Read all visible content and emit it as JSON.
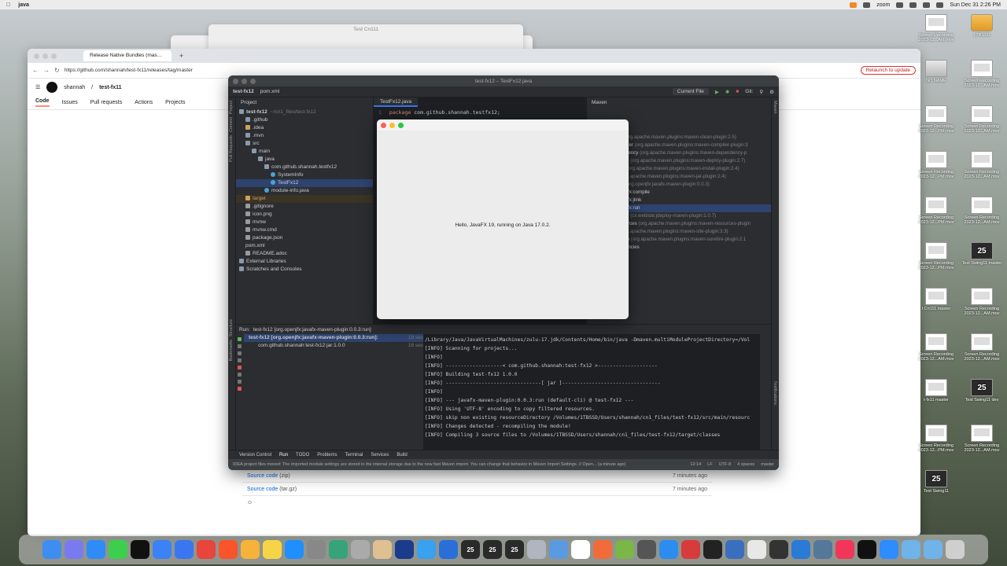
{
  "menubar": {
    "app": "java",
    "clock": "Sun Dec 31  2:26 PM",
    "zoom": "zoom"
  },
  "ghost_window_title": "Test Cn111",
  "browser": {
    "tab_title": "Release Native Bundles (mas…",
    "url": "https://github.com/shannah/test-fx11/releases/tag/master",
    "relaunch": "Relaunch to update",
    "breadcrumb_owner": "shannah",
    "breadcrumb_sep": "/",
    "breadcrumb_repo": "test-fx11",
    "tabs": [
      "Code",
      "Issues",
      "Pull requests",
      "Actions",
      "Projects"
    ],
    "assets": [
      {
        "name": "Source code",
        "type": "(zip)",
        "time": "7 minutes ago"
      },
      {
        "name": "Source code",
        "type": "(tar.gz)",
        "time": "7 minutes ago"
      }
    ]
  },
  "ide": {
    "title": "test-fx12 – TestFx12.java",
    "project_name": "test-fx12",
    "pom_breadcrumb": "pom.xml",
    "run_config": "Current File",
    "git_label": "Git:",
    "project_pane_label": "Project",
    "maven_pane_label": "Maven",
    "left_strip": [
      "Project",
      "Commit",
      "Pull Requests",
      "Structure",
      "Bookmarks"
    ],
    "right_strip": [
      "Maven",
      "Notifications"
    ],
    "tree": [
      {
        "indent": 0,
        "label": "test-fx12",
        "hint": "~/cn1_files/test-fx12",
        "icon": "folder"
      },
      {
        "indent": 1,
        "label": ".github",
        "icon": "folder"
      },
      {
        "indent": 1,
        "label": ".idea",
        "icon": "orange"
      },
      {
        "indent": 1,
        "label": ".mvn",
        "icon": "folder"
      },
      {
        "indent": 1,
        "label": "src",
        "icon": "folder"
      },
      {
        "indent": 2,
        "label": "main",
        "icon": "folder"
      },
      {
        "indent": 3,
        "label": "java",
        "icon": "folder"
      },
      {
        "indent": 4,
        "label": "com.github.shannah.testfx12",
        "icon": "folder"
      },
      {
        "indent": 5,
        "label": "SystemInfo",
        "icon": "java"
      },
      {
        "indent": 5,
        "label": "TestFx12",
        "icon": "java",
        "selected": true
      },
      {
        "indent": 4,
        "label": "module-info.java",
        "icon": "java"
      },
      {
        "indent": 1,
        "label": "target",
        "icon": "orange",
        "excluded": true
      },
      {
        "indent": 1,
        "label": ".gitignore",
        "icon": "file"
      },
      {
        "indent": 1,
        "label": "icon.png",
        "icon": "file"
      },
      {
        "indent": 1,
        "label": "mvnw",
        "icon": "file"
      },
      {
        "indent": 1,
        "label": "mvnw.cmd",
        "icon": "file"
      },
      {
        "indent": 1,
        "label": "package.json",
        "icon": "file"
      },
      {
        "indent": 1,
        "label": "pom.xml",
        "icon": "maven"
      },
      {
        "indent": 1,
        "label": "README.adoc",
        "icon": "file"
      },
      {
        "indent": 0,
        "label": "External Libraries",
        "icon": "folder"
      },
      {
        "indent": 0,
        "label": "Scratches and Consoles",
        "icon": "folder"
      }
    ],
    "editor_tab": "TestFx12.java",
    "editor_line_no": "1",
    "editor_keyword": "package",
    "editor_code": " com.github.shannah.testfx12;",
    "maven_rows": [
      {
        "a": "le",
        "b": ""
      },
      {
        "a": "n",
        "b": "(org.apache.maven.plugins:maven-clean-plugin:2.5)"
      },
      {
        "a": "mpiler",
        "b": "(org.apache.maven.plugins:maven-compiler-plugin:3"
      },
      {
        "a": "endency",
        "b": "(org.apache.maven.plugins:maven-dependency-p"
      },
      {
        "a": "oloy",
        "b": "(org.apache.maven.plugins:maven-deploy-plugin:2.7)"
      },
      {
        "a": "all",
        "b": "(org.apache.maven.plugins:maven-install-plugin:2.4)"
      },
      {
        "a": "",
        "b": "(org.apache.maven.plugins:maven-jar-plugin:2.4)"
      },
      {
        "a": "fx",
        "b": "(org.openjfx:javafx-maven-plugin:0.0.3)"
      },
      {
        "a": "avafx:compile",
        "b": ""
      },
      {
        "a": "avafx:jlink",
        "b": ""
      },
      {
        "a": "avafx:run",
        "b": "",
        "selected": true
      },
      {
        "a": "oloy",
        "b": "(cx.webiste:jdeploy-maven-plugin:1.0.7)"
      },
      {
        "a": "sources",
        "b": "(org.apache.maven.plugins:maven-resources-plugin"
      },
      {
        "a": "",
        "b": "(org.apache.maven.plugins:maven-site-plugin:3.3)"
      },
      {
        "a": "efire",
        "b": "(org.apache.maven.plugins:maven-surefire-plugin:2.1"
      },
      {
        "a": "ndencies",
        "b": ""
      }
    ],
    "run": {
      "label": "Run:",
      "config": "test-fx12 [org.openjfx:javafx-maven-plugin:0.0.3:run]",
      "root": "test-fx12 [org.openjfx:javafx-maven-plugin:0.0.3:run]:",
      "root_time": "18 sec",
      "child": "com.github.shannah:test-fx12:jar:1.0.0",
      "child_time": "16 sec"
    },
    "console": [
      {
        "t": "/Library/Java/JavaVirtualMachines/zulu-17.jdk/Contents/Home/bin/java -Dmaven.multiModuleProjectDirectory=/Vol"
      },
      {
        "t": "[INFO] Scanning for projects..."
      },
      {
        "t": "[INFO]"
      },
      {
        "t": "[INFO] -------------------< com.github.shannah:test-fx12 >--------------------"
      },
      {
        "t": "[INFO] Building test-fx12 1.0.0"
      },
      {
        "t": "[INFO] --------------------------------[ jar ]---------------------------------"
      },
      {
        "t": "[INFO]"
      },
      {
        "t": "[INFO] --- javafx-maven-plugin:0.0.3:run (default-cli) @ test-fx12 ---"
      },
      {
        "t": "[INFO] Using 'UTF-8' encoding to copy filtered resources."
      },
      {
        "t": "[INFO] skip non existing resourceDirectory /Volumes/1TBSSD/Users/shannah/cn1_files/test-fx12/src/main/resourc"
      },
      {
        "t": "[INFO] Changes detected - recompiling the module!"
      },
      {
        "t": "[INFO] Compiling 3 source files to /Volumes/1TBSSD/Users/shannah/cn1_files/test-fx12/target/classes"
      }
    ],
    "bottom_tabs": [
      "Version Control",
      "Run",
      "TODO",
      "Problems",
      "Terminal",
      "Services",
      "Build"
    ],
    "status_msg": "IDEA project files moved: The imported module settings are stored in the internal storage due to the new fast Maven import. You can change that behavior in Maven Import Settings. // Open... (a minute ago)",
    "status_right": [
      "12:14",
      "LF",
      "UTF-8",
      "4 spaces",
      "master"
    ]
  },
  "fx_window": {
    "message": "Hello, JavaFX 19, running on Java 17.0.2."
  },
  "desktop_icons": [
    {
      "label": "Screen Recording 2023-12...AM.mov",
      "kind": "rec"
    },
    {
      "label": "1TBSSD",
      "kind": "drive"
    },
    {
      "label": "NO NAME",
      "kind": "disk"
    },
    {
      "label": "Screen Recording 2023-12...AM.mov",
      "kind": "rec"
    },
    {
      "label": "Screen Recording 2023-12...PM.mov",
      "kind": "rec"
    },
    {
      "label": "Screen Recording 2023-12...AM.mov",
      "kind": "rec"
    },
    {
      "label": "Screen Recording 2023-12...PM.mov",
      "kind": "rec"
    },
    {
      "label": "Screen Recording 2023-12...AM.mov",
      "kind": "rec"
    },
    {
      "label": "Screen Recording 2023-12...PM.mov",
      "kind": "rec"
    },
    {
      "label": "Screen Recording 2023-12...AM.mov",
      "kind": "rec"
    },
    {
      "label": "Screen Recording 2023-12...PM.mov",
      "kind": "rec"
    },
    {
      "label": "Test Swing11 master",
      "kind": "badge"
    },
    {
      "label": "t Cn111 master",
      "kind": "rec"
    },
    {
      "label": "Screen Recording 2023-12...AM.mov",
      "kind": "rec"
    },
    {
      "label": "Screen Recording 2023-12...AM.mov",
      "kind": "rec"
    },
    {
      "label": "Screen Recording 2023-12...AM.mov",
      "kind": "rec"
    },
    {
      "label": "t-fx11 master",
      "kind": "rec"
    },
    {
      "label": "Test Swing11 dev",
      "kind": "badge"
    },
    {
      "label": "Screen Recording 2023-12...PM.mov",
      "kind": "rec"
    },
    {
      "label": "Screen Recording 2023-12...AM.mov",
      "kind": "rec"
    },
    {
      "label": "Test Swing11",
      "kind": "badge"
    }
  ],
  "badge_text": "25",
  "dock_apps": [
    {
      "name": "Finder",
      "color": "#3d8ef0"
    },
    {
      "name": "Launchpad",
      "color": "#7a7af0"
    },
    {
      "name": "Safari",
      "color": "#2f8bf5"
    },
    {
      "name": "Messages",
      "color": "#3ccf4e"
    },
    {
      "name": "IntelliJ",
      "color": "#111111"
    },
    {
      "name": "Mail",
      "color": "#3b82f6"
    },
    {
      "name": "Signal",
      "color": "#3a76f0"
    },
    {
      "name": "Chrome",
      "color": "#e8453c"
    },
    {
      "name": "Brave",
      "color": "#fb542b"
    },
    {
      "name": "Photos",
      "color": "#f6b33a"
    },
    {
      "name": "Notes",
      "color": "#f5d547"
    },
    {
      "name": "App Store",
      "color": "#1f8fff"
    },
    {
      "name": "Settings",
      "color": "#888888"
    },
    {
      "name": "Git",
      "color": "#37a37a"
    },
    {
      "name": "S",
      "color": "#aaaaaa"
    },
    {
      "name": "Duke",
      "color": "#e0c090"
    },
    {
      "name": "VS",
      "color": "#1b3c8c"
    },
    {
      "name": "Xcode",
      "color": "#3aa0f0"
    },
    {
      "name": "Sim",
      "color": "#2a6fd8"
    },
    {
      "name": "25a",
      "color": "#2a2a2a"
    },
    {
      "name": "25b",
      "color": "#2a2a2a"
    },
    {
      "name": "25c",
      "color": "#2a2a2a"
    },
    {
      "name": "T",
      "color": "#b0b6c0"
    },
    {
      "name": "Preview",
      "color": "#5a9ae0"
    },
    {
      "name": "Duke2",
      "color": "#ffffff"
    },
    {
      "name": "Pen",
      "color": "#f26b3a"
    },
    {
      "name": "Snake",
      "color": "#7ab648"
    },
    {
      "name": "Cam",
      "color": "#555555"
    },
    {
      "name": "Compass",
      "color": "#2d8cf0"
    },
    {
      "name": "NoEntry",
      "color": "#d83b3b"
    },
    {
      "name": "Terminal",
      "color": "#222222"
    },
    {
      "name": "Storage",
      "color": "#3a6fc0"
    },
    {
      "name": "TextEdit",
      "color": "#e8e8e8"
    },
    {
      "name": "Warn",
      "color": "#333333"
    },
    {
      "name": "VSCode",
      "color": "#2a7ad6"
    },
    {
      "name": "Bridge",
      "color": "#557799"
    },
    {
      "name": "Music",
      "color": "#f2365a"
    },
    {
      "name": "tv",
      "color": "#111111"
    },
    {
      "name": "zoom",
      "color": "#2d8cff"
    },
    {
      "name": "Folder",
      "color": "#6fb3e8"
    },
    {
      "name": "Downloads",
      "color": "#6fb3e8"
    },
    {
      "name": "Trash",
      "color": "#cfcfcf"
    }
  ]
}
